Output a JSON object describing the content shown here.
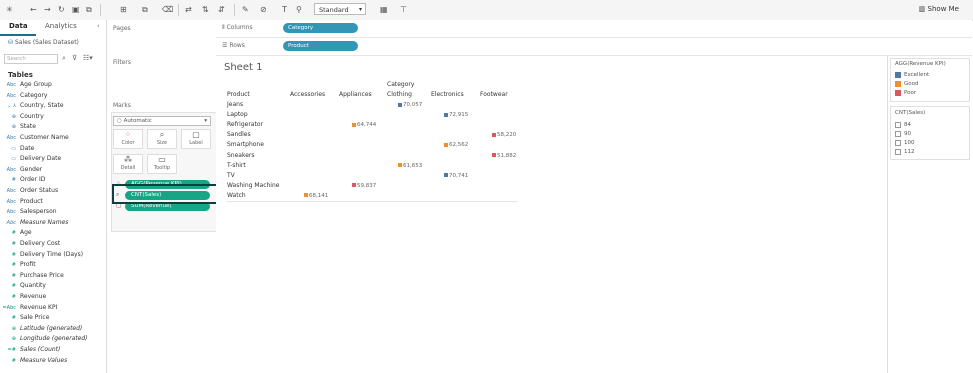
{
  "toolbar": {
    "format_select": "Standard",
    "show_me_label": "Show Me"
  },
  "datapane": {
    "tabs": [
      "Data",
      "Analytics"
    ],
    "datasource": "Sales (Sales Dataset)",
    "search_placeholder": "Search",
    "tables_heading": "Tables",
    "fields": [
      {
        "type": "Abc",
        "name": "Age Group"
      },
      {
        "type": "Abc",
        "name": "Category"
      },
      {
        "type": "⌄ ⅄",
        "name": "Country, State"
      },
      {
        "type": "⊕",
        "name": "Country"
      },
      {
        "type": "⊕",
        "name": "State"
      },
      {
        "type": "Abc",
        "name": "Customer Name"
      },
      {
        "type": "▭",
        "name": "Date"
      },
      {
        "type": "▭",
        "name": "Delivery Date"
      },
      {
        "type": "Abc",
        "name": "Gender"
      },
      {
        "type": "#",
        "name": "Order ID"
      },
      {
        "type": "Abc",
        "name": "Order Status"
      },
      {
        "type": "Abc",
        "name": "Product"
      },
      {
        "type": "Abc",
        "name": "Salesperson"
      },
      {
        "type": "Abc",
        "name": "Measure Names"
      },
      {
        "type": "#",
        "name": "Age"
      },
      {
        "type": "#",
        "name": "Delivery Cost"
      },
      {
        "type": "#",
        "name": "Delivery Time (Days)"
      },
      {
        "type": "#",
        "name": "Profit"
      },
      {
        "type": "#",
        "name": "Purchase Price"
      },
      {
        "type": "#",
        "name": "Quantity"
      },
      {
        "type": "#",
        "name": "Revenue"
      },
      {
        "type": "=Abc",
        "name": "Revenue KPI"
      },
      {
        "type": "#",
        "name": "Sale Price"
      },
      {
        "type": "⊕",
        "name": "Latitude (generated)"
      },
      {
        "type": "⊕",
        "name": "Longitude (generated)"
      },
      {
        "type": "=#",
        "name": "Sales (Count)"
      },
      {
        "type": "#",
        "name": "Measure Values"
      }
    ]
  },
  "cards": {
    "pages": "Pages",
    "filters": "Filters",
    "marks": "Marks",
    "mark_type": "Automatic",
    "buttons": [
      "Color",
      "Size",
      "Label",
      "Detail",
      "Tooltip"
    ],
    "pills": [
      "AGG(Revenue KPI)",
      "CNT(Sales)",
      "SUM(Revenue)"
    ]
  },
  "shelves": {
    "columns_label": "Columns",
    "columns_pill": "Category",
    "rows_label": "Rows",
    "rows_pill": "Product"
  },
  "view": {
    "sheet_title": "Sheet 1",
    "column_header_title": "Category",
    "row_header_title": "Product",
    "categories": [
      "Accessories",
      "Appliances",
      "Clothing",
      "Electronics",
      "Footwear"
    ],
    "products": [
      "Jeans",
      "Laptop",
      "Refrigerator",
      "Sandles",
      "Smartphone",
      "Sneakers",
      "T-shirt",
      "TV",
      "Washing Machine",
      "Watch"
    ],
    "marks": [
      {
        "product": "Jeans",
        "category": "Clothing",
        "label": "70,057",
        "kpi": "Excellent"
      },
      {
        "product": "Laptop",
        "category": "Electronics",
        "label": "72,915",
        "kpi": "Excellent"
      },
      {
        "product": "Refrigerator",
        "category": "Appliances",
        "label": "64,744",
        "kpi": "Good"
      },
      {
        "product": "Sandles",
        "category": "Footwear",
        "label": "58,220",
        "kpi": "Poor"
      },
      {
        "product": "Smartphone",
        "category": "Electronics",
        "label": "62,562",
        "kpi": "Good"
      },
      {
        "product": "Sneakers",
        "category": "Footwear",
        "label": "51,882",
        "kpi": "Poor"
      },
      {
        "product": "T-shirt",
        "category": "Clothing",
        "label": "61,653",
        "kpi": "Good"
      },
      {
        "product": "TV",
        "category": "Electronics",
        "label": "70,741",
        "kpi": "Excellent"
      },
      {
        "product": "Washing Machine",
        "category": "Appliances",
        "label": "59,837",
        "kpi": "Poor"
      },
      {
        "product": "Watch",
        "category": "Accessories",
        "label": "68,141",
        "kpi": "Good"
      }
    ]
  },
  "legend": {
    "color_title": "AGG(Revenue KPI)",
    "color_items": [
      {
        "label": "Excellent",
        "color": "#4e79a7"
      },
      {
        "label": "Good",
        "color": "#f28e2b"
      },
      {
        "label": "Poor",
        "color": "#e15759"
      }
    ],
    "size_title": "CNT(Sales)",
    "size_items": [
      "84",
      "90",
      "100",
      "112"
    ]
  }
}
